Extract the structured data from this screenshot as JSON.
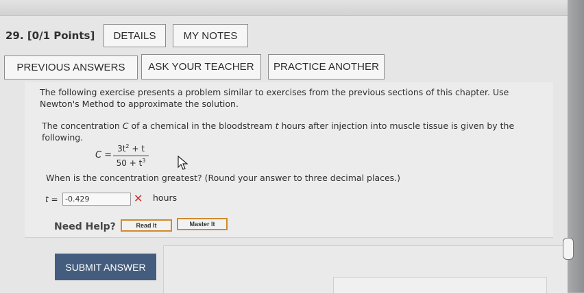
{
  "question": {
    "number_label": "29.",
    "points_label": "[0/1 Points]"
  },
  "toolbar": {
    "details": "DETAILS",
    "my_notes": "MY NOTES",
    "previous_answers": "PREVIOUS ANSWERS",
    "ask_teacher": "ASK YOUR TEACHER",
    "practice_another": "PRACTICE ANOTHER"
  },
  "problem": {
    "intro": "The following exercise presents a problem similar to exercises from the previous sections of this chapter. Use Newton's Method to approximate the solution.",
    "statement_prefix": "The concentration",
    "statement_var_c": "C",
    "statement_mid": "of a chemical in the bloodstream",
    "statement_var_t": "t",
    "statement_suffix": "hours after injection into muscle tissue is given by the following.",
    "formula_lhs": "C",
    "formula_eq": "=",
    "formula_num_base": "3t",
    "formula_num_exp": "2",
    "formula_num_rest": "+ t",
    "formula_den_base": "50 + t",
    "formula_den_exp": "3",
    "prompt": "When is the concentration greatest? (Round your answer to three decimal places.)"
  },
  "answer": {
    "label": "t =",
    "value": "-0.429",
    "status_icon": "incorrect-x-icon",
    "unit": "hours"
  },
  "help": {
    "label": "Need Help?",
    "read_it": "Read It",
    "master_it": "Master It"
  },
  "submit": {
    "label": "SUBMIT ANSWER"
  },
  "colors": {
    "submit_bg": "#445c7d",
    "help_border": "#d08a2e",
    "incorrect": "#c8302b"
  }
}
